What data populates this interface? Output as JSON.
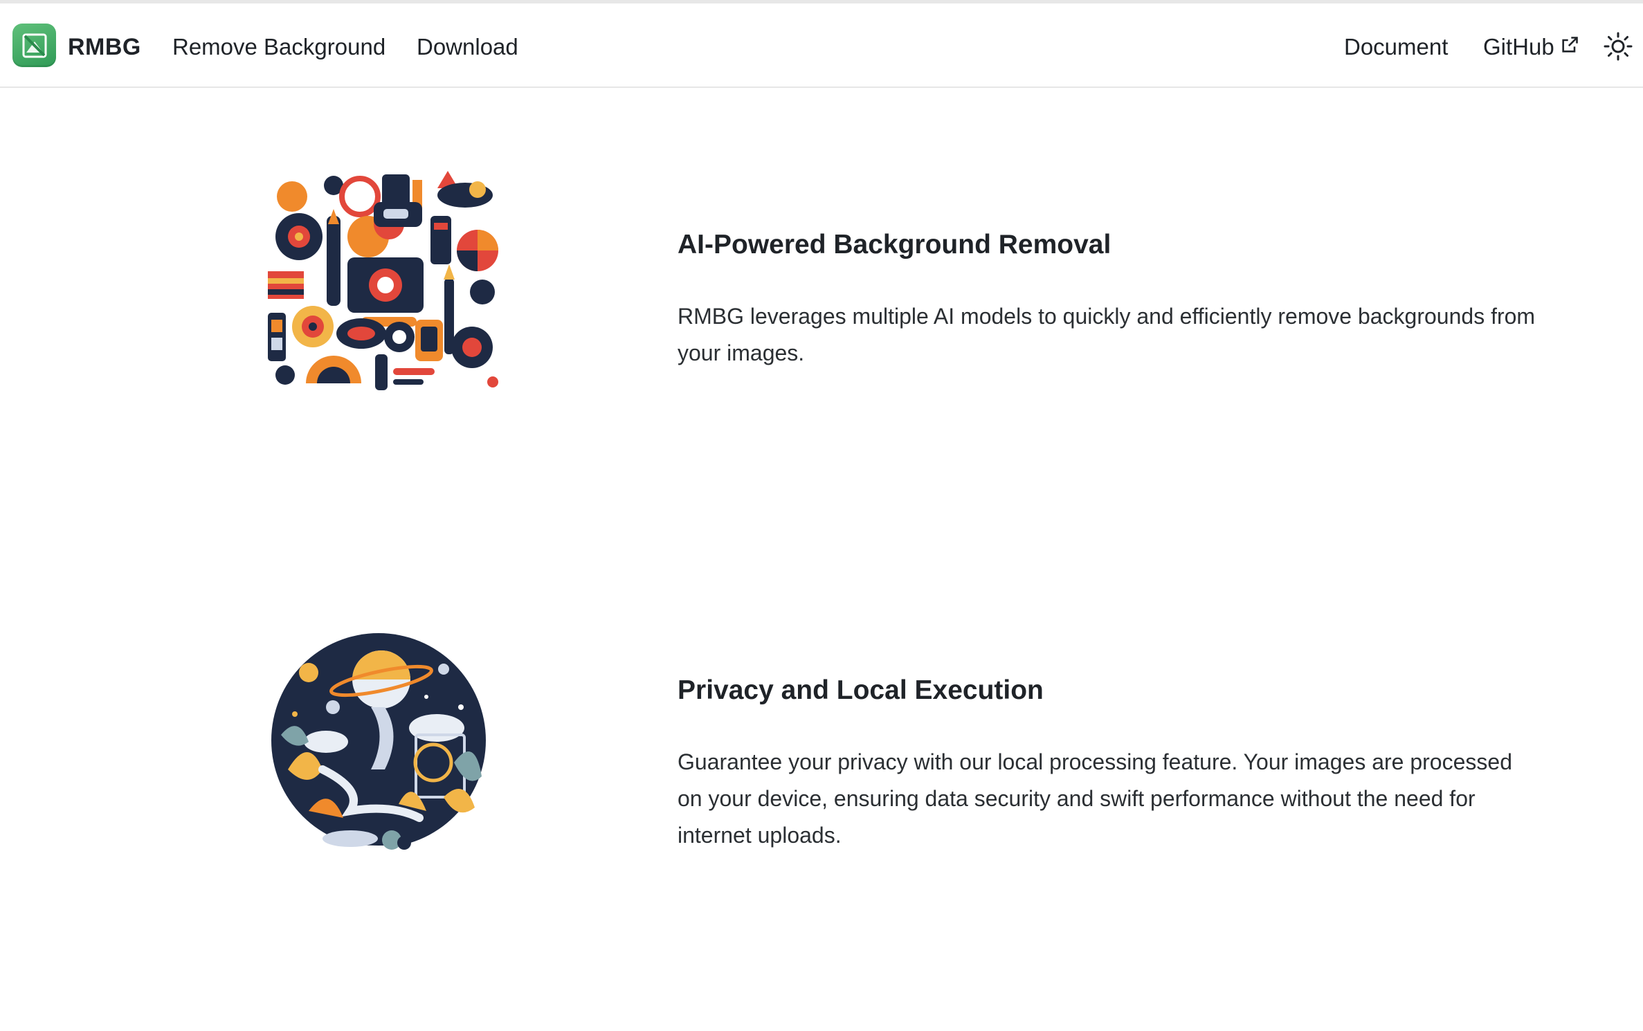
{
  "nav": {
    "brand": "RMBG",
    "links": [
      {
        "label": "Remove Background"
      },
      {
        "label": "Download"
      }
    ],
    "right_links": [
      {
        "label": "Document"
      },
      {
        "label": "GitHub"
      }
    ],
    "logo_icon": "rmbg-logo-icon",
    "external_icon": "external-link-icon",
    "theme_icon": "sun-icon"
  },
  "features": [
    {
      "title": "AI-Powered Background Removal",
      "description": "RMBG leverages multiple AI models to quickly and efficiently remove backgrounds from your images.",
      "illustration": "abstract-creative-tools-illustration"
    },
    {
      "title": "Privacy and Local Execution",
      "description": "Guarantee your privacy with our local processing feature. Your images are processed on your device, ensuring data security and swift performance without the need for internet uploads.",
      "illustration": "night-garden-planet-illustration"
    }
  ],
  "colors": {
    "brand_green": "#3aa862",
    "text": "#1f2328",
    "navy": "#1e2a44",
    "orange": "#f08a2c",
    "red": "#e2473b",
    "gold": "#f2b548"
  }
}
